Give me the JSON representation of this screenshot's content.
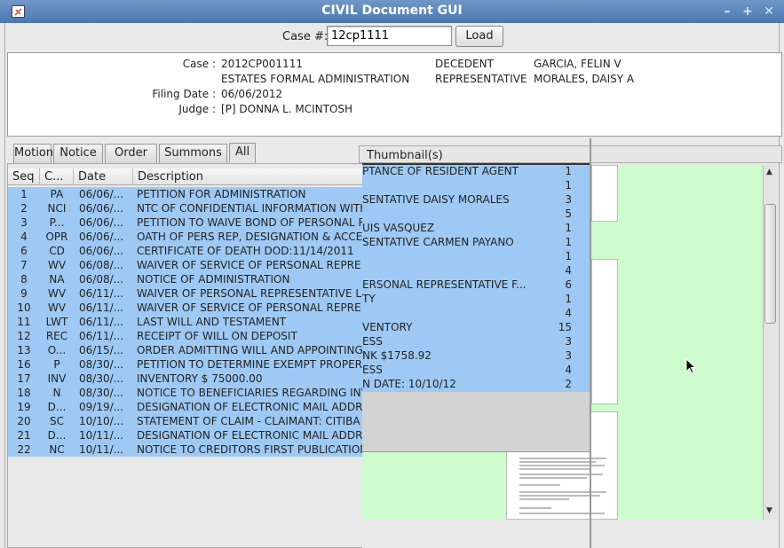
{
  "window": {
    "title": "CIVIL Document GUI"
  },
  "search": {
    "label": "Case #:",
    "value": "12cp1111",
    "load_label": "Load"
  },
  "case_info": {
    "case_label": "Case :",
    "case_value": "2012CP001111",
    "case_type": "ESTATES FORMAL ADMINISTRATION",
    "filing_label": "Filing Date :",
    "filing_value": "06/06/2012",
    "judge_label": "Judge :",
    "judge_value": "[P] DONNA L. MCINTOSH",
    "decedent_label": "DECEDENT",
    "decedent_value": "GARCIA, FELIN V",
    "rep_label": "REPRESENTATIVE",
    "rep_value": "MORALES, DAISY A"
  },
  "tabs": [
    "Motion",
    "Notice",
    "Order",
    "Summons",
    "All"
  ],
  "active_tab": "All",
  "table": {
    "headers": [
      "Seq",
      "C...",
      "Date",
      "Description"
    ],
    "rows": [
      [
        "1",
        "PA",
        "06/06/...",
        "PETITION FOR ADMINISTRATION"
      ],
      [
        "2",
        "NCI",
        "06/06/...",
        "NTC OF CONFIDENTIAL INFORMATION WITH"
      ],
      [
        "3",
        "P...",
        "06/06/...",
        "PETITION TO WAIVE BOND OF PERSONAL R"
      ],
      [
        "4",
        "OPR",
        "06/06/...",
        "OATH OF PERS REP, DESIGNATION & ACCE"
      ],
      [
        "6",
        "CD",
        "06/06/...",
        "CERTIFICATE OF DEATH  DOD:11/14/2011"
      ],
      [
        "7",
        "WV",
        "06/08/...",
        "WAIVER OF SERVICE OF PERSONAL REPRE"
      ],
      [
        "8",
        "NA",
        "06/08/...",
        "NOTICE OF ADMINISTRATION"
      ],
      [
        "9",
        "WV",
        "06/11/...",
        "WAIVER OF PERSONAL REPRESENTATIVE L"
      ],
      [
        "10",
        "WV",
        "06/11/...",
        "WAIVER OF SERVICE OF PERSONAL REPRE"
      ],
      [
        "11",
        "LWT",
        "06/11/...",
        "LAST WILL AND TESTAMENT"
      ],
      [
        "12",
        "REC",
        "06/11/...",
        "RECEIPT OF WILL ON DEPOSIT"
      ],
      [
        "13",
        "O...",
        "06/15/...",
        "ORDER ADMITTING WILL AND APPOINTING"
      ],
      [
        "16",
        "P",
        "08/30/...",
        "PETITION TO DETERMINE EXEMPT PROPER"
      ],
      [
        "17",
        "INV",
        "08/30/...",
        "INVENTORY  $ 75000.00"
      ],
      [
        "18",
        "N",
        "08/30/...",
        "NOTICE TO BENEFICIARIES REGARDING INV"
      ],
      [
        "19",
        "D...",
        "09/19/...",
        "DESIGNATION OF ELECTRONIC MAIL ADDRE"
      ],
      [
        "20",
        "SC",
        "10/10/...",
        "STATEMENT OF CLAIM  -  CLAIMANT: CITIBA"
      ],
      [
        "21",
        "D...",
        "10/11/...",
        "DESIGNATION OF ELECTRONIC MAIL ADDRE"
      ],
      [
        "22",
        "NC",
        "10/11/...",
        "NOTICE TO CREDITORS  FIRST PUBLICATION"
      ]
    ]
  },
  "thumbnails": {
    "header": "Thumbnail(s)"
  },
  "popup_rows": [
    [
      "PTANCE OF RESIDENT AGENT",
      "1"
    ],
    [
      "",
      "1"
    ],
    [
      "SENTATIVE DAISY MORALES",
      "3"
    ],
    [
      "",
      "5"
    ],
    [
      "UIS VASQUEZ",
      "1"
    ],
    [
      "SENTATIVE CARMEN PAYANO",
      "1"
    ],
    [
      "",
      "1"
    ],
    [
      "",
      "4"
    ],
    [
      "ERSONAL REPRESENTATIVE F...",
      "6"
    ],
    [
      "TY",
      "1"
    ],
    [
      "",
      "4"
    ],
    [
      "VENTORY",
      "15"
    ],
    [
      "ESS",
      "3"
    ],
    [
      "NK $1758.92",
      "3"
    ],
    [
      "ESS",
      "4"
    ],
    [
      "N DATE: 10/10/12",
      "2"
    ]
  ],
  "colors": {
    "title_bar": "#5b86bd",
    "selection": "#9ec9f5",
    "thumb_bg": "#cdfbcd"
  }
}
